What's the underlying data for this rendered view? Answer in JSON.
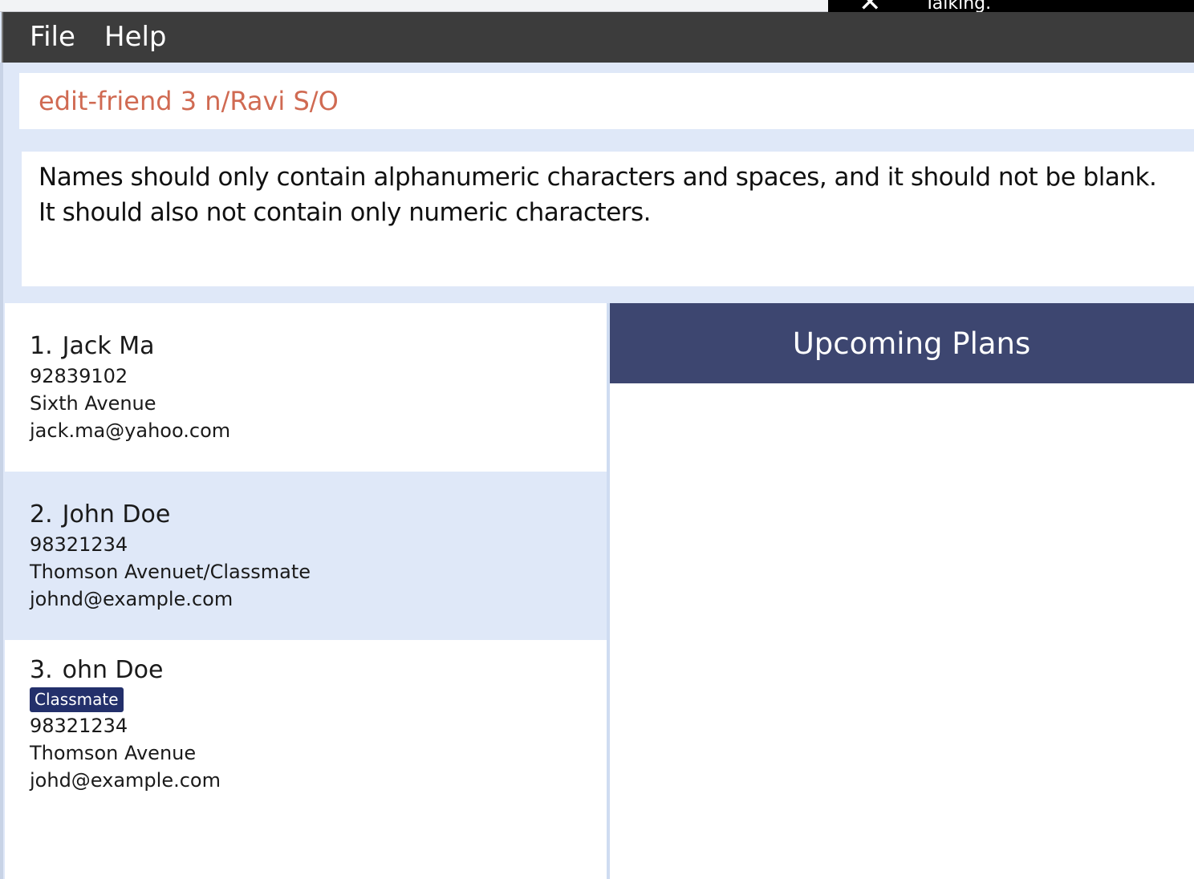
{
  "menu": {
    "file_label": "File",
    "help_label": "Help"
  },
  "notification": {
    "text": "Talking."
  },
  "command": {
    "value": "edit-friend 3 n/Ravi S/O"
  },
  "result": {
    "line1": "Names should only contain alphanumeric characters and spaces, and it should not be blank.",
    "line2": "It should also not contain only numeric characters."
  },
  "friends": [
    {
      "index": "1.",
      "name": "Jack Ma",
      "tags": [],
      "phone": "92839102",
      "address": "Sixth Avenue",
      "email": "jack.ma@yahoo.com"
    },
    {
      "index": "2.",
      "name": "John Doe",
      "tags": [],
      "phone": "98321234",
      "address": "Thomson Avenuet/Classmate",
      "email": "johnd@example.com"
    },
    {
      "index": "3.",
      "name": "ohn Doe",
      "tags": [
        "Classmate"
      ],
      "phone": "98321234",
      "address": "Thomson Avenue",
      "email": "johd@example.com"
    }
  ],
  "plans": {
    "title": "Upcoming Plans"
  },
  "colors": {
    "menubar": "#3c3c3c",
    "command_text": "#d06a52",
    "selected_card": "#dfe8f8",
    "tag_bg": "#23306b",
    "plans_header": "#3d4670"
  }
}
